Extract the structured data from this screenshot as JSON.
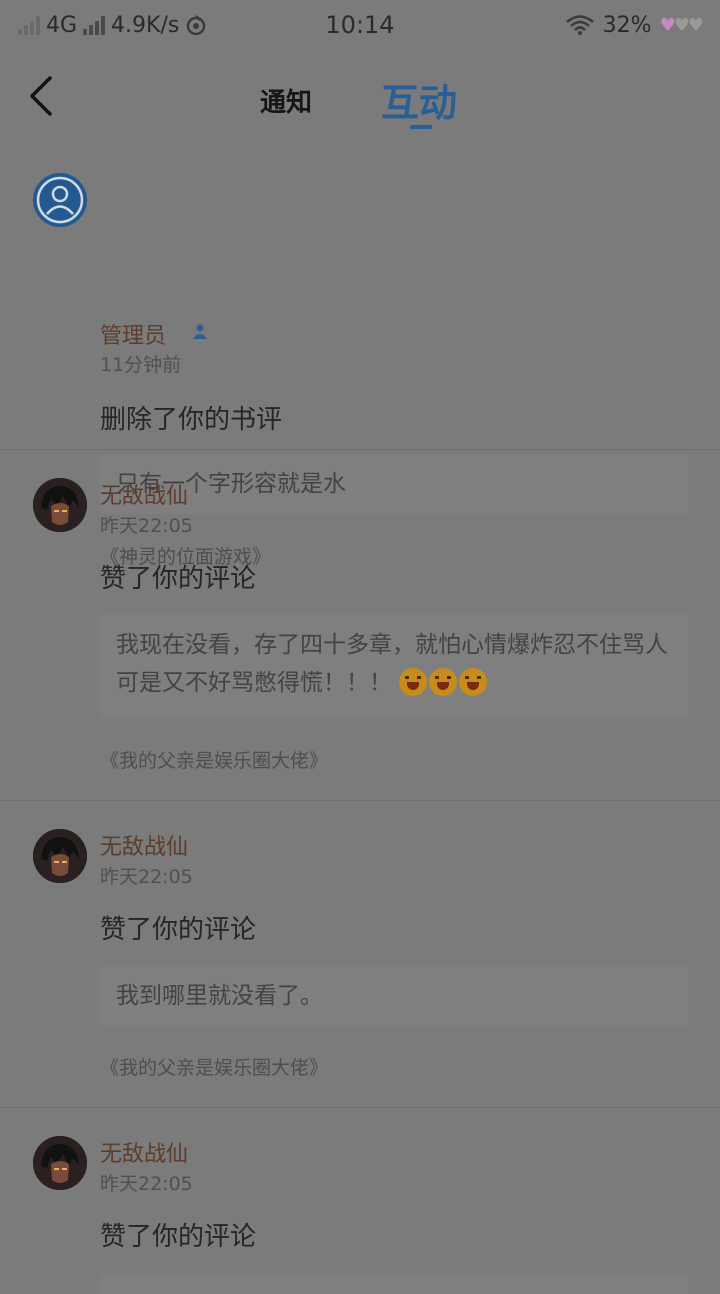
{
  "status_bar": {
    "network": "4G",
    "speed": "4.9K/s",
    "time": "10:14",
    "battery": "32%",
    "icons": [
      "signal-icon",
      "wifi-icon",
      "hotspot-icon",
      "heart-battery-icon"
    ]
  },
  "header": {
    "back_icon": "back-arrow-icon",
    "tabs": [
      {
        "label": "通知",
        "active": false
      },
      {
        "label": "互动",
        "active": true
      }
    ],
    "accent_color": "#2a5f95"
  },
  "notifications": [
    {
      "name": "管理员",
      "verified_icon": "admin-badge-icon",
      "avatar_icon": "default-user-avatar-icon",
      "time": "11分钟前",
      "action": "删除了你的书评",
      "quote": "只有一个字形容就是水",
      "book": "《神灵的位面游戏》"
    },
    {
      "name": "无敌战仙",
      "avatar_icon": "user-avatar-icon",
      "time": "昨天22:05",
      "action": "赞了你的评论",
      "quote": "我现在没看，存了四十多章，就怕心情爆炸忍不住骂人可是又不好骂憋得慌！！！",
      "emoji_icon": "crying-laughing-emoji-icon",
      "emoji_count": 3,
      "book": "《我的父亲是娱乐圈大佬》"
    },
    {
      "name": "无敌战仙",
      "avatar_icon": "user-avatar-icon",
      "time": "昨天22:05",
      "action": "赞了你的评论",
      "quote": "我到哪里就没看了。",
      "book": "《我的父亲是娱乐圈大佬》"
    },
    {
      "name": "无敌战仙",
      "avatar_icon": "user-avatar-icon",
      "time": "昨天22:05",
      "action": "赞了你的评论"
    }
  ]
}
